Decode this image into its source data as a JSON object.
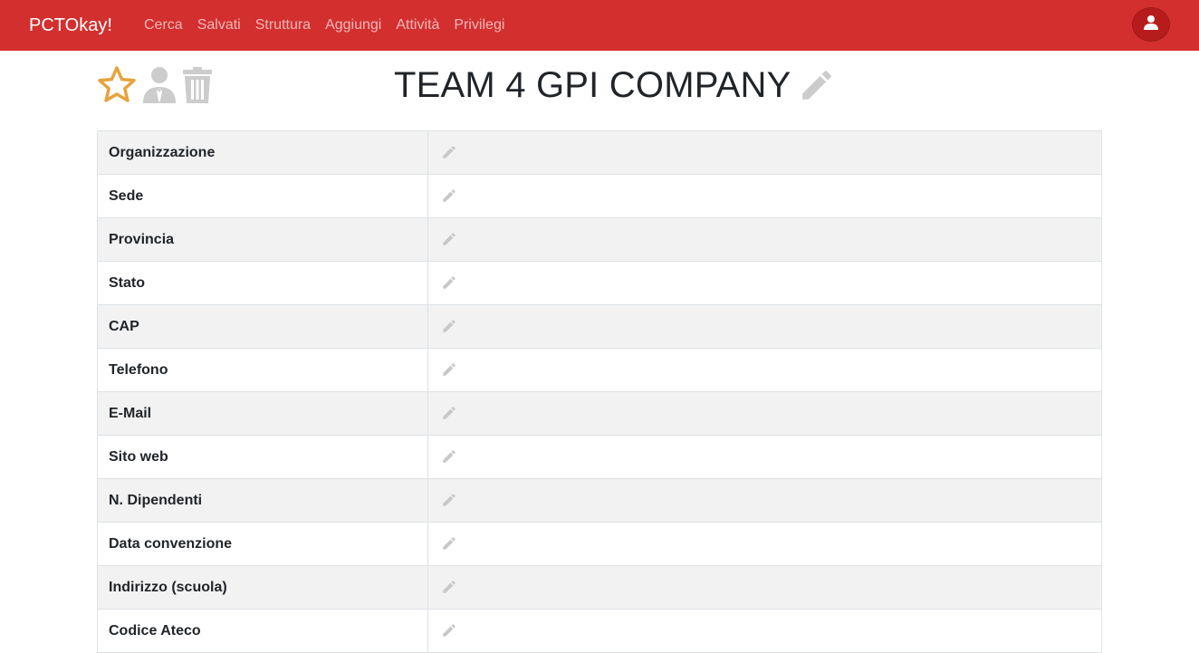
{
  "navbar": {
    "brand": "PCTOkay!",
    "links": [
      {
        "label": "Cerca"
      },
      {
        "label": "Salvati"
      },
      {
        "label": "Struttura"
      },
      {
        "label": "Aggiungi"
      },
      {
        "label": "Attività"
      },
      {
        "label": "Privilegi"
      }
    ],
    "user_icon": "user-icon",
    "color": "#d32f2f"
  },
  "actions": {
    "favorite_icon": "star-outline-icon",
    "favorite_color": "#e8a33d",
    "tutor_icon": "user-tie-icon",
    "delete_icon": "trash-icon",
    "muted_color": "#cccccc"
  },
  "title": {
    "text": "TEAM 4 GPI COMPANY",
    "edit_icon": "pencil-icon"
  },
  "fields": [
    {
      "label": "Organizzazione",
      "value": ""
    },
    {
      "label": "Sede",
      "value": ""
    },
    {
      "label": "Provincia",
      "value": ""
    },
    {
      "label": "Stato",
      "value": ""
    },
    {
      "label": "CAP",
      "value": ""
    },
    {
      "label": "Telefono",
      "value": ""
    },
    {
      "label": "E-Mail",
      "value": ""
    },
    {
      "label": "Sito web",
      "value": ""
    },
    {
      "label": "N. Dipendenti",
      "value": ""
    },
    {
      "label": "Data convenzione",
      "value": ""
    },
    {
      "label": "Indirizzo (scuola)",
      "value": ""
    },
    {
      "label": "Codice Ateco",
      "value": ""
    }
  ]
}
